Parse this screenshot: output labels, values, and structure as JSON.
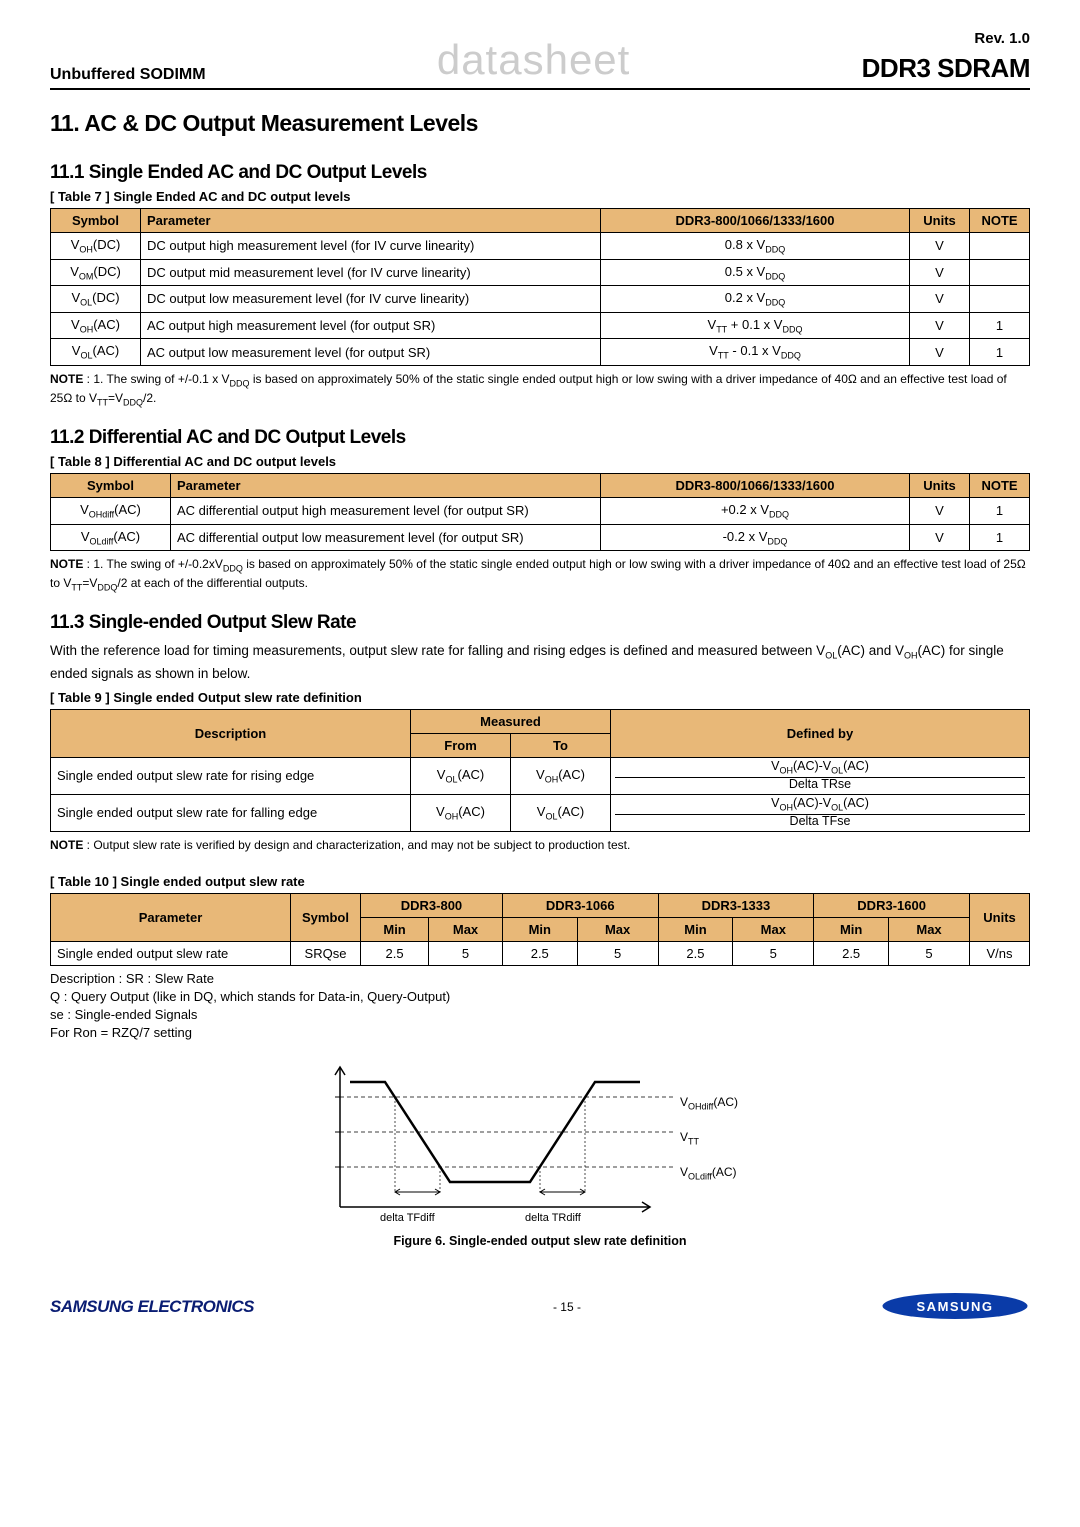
{
  "header": {
    "left": "Unbuffered SODIMM",
    "center": "datasheet",
    "rev": "Rev. 1.0",
    "title": "DDR3 SDRAM"
  },
  "h1": "11. AC & DC Output Measurement Levels",
  "sec1": {
    "heading": "11.1 Single Ended AC and DC Output Levels",
    "caption": "[ Table 7 ] Single Ended AC and DC output levels",
    "th_symbol": "Symbol",
    "th_parameter": "Parameter",
    "th_speed": "DDR3-800/1066/1333/1600",
    "th_units": "Units",
    "th_note": "NOTE",
    "rows": [
      {
        "sym": "V",
        "sub": "OH",
        "suf": "(DC)",
        "param": "DC output high measurement level (for IV curve linearity)",
        "val": "0.8 x V",
        "vsub": "DDQ",
        "units": "V",
        "note": ""
      },
      {
        "sym": "V",
        "sub": "OM",
        "suf": "(DC)",
        "param": "DC output mid measurement level (for IV curve linearity)",
        "val": "0.5 x V",
        "vsub": "DDQ",
        "units": "V",
        "note": ""
      },
      {
        "sym": "V",
        "sub": "OL",
        "suf": "(DC)",
        "param": "DC output low measurement level (for IV curve linearity)",
        "val": "0.2 x V",
        "vsub": "DDQ",
        "units": "V",
        "note": ""
      },
      {
        "sym": "V",
        "sub": "OH",
        "suf": "(AC)",
        "param": "AC output high measurement level (for output SR)",
        "val_pre": "V",
        "val_pre_sub": "TT",
        "val_mid": " + 0.1 x V",
        "vsub": "DDQ",
        "units": "V",
        "note": "1"
      },
      {
        "sym": "V",
        "sub": "OL",
        "suf": "(AC)",
        "param": "AC output low measurement level (for output SR)",
        "val_pre": "V",
        "val_pre_sub": "TT",
        "val_mid": " - 0.1 x V",
        "vsub": "DDQ",
        "units": "V",
        "note": "1"
      }
    ],
    "note_label": "NOTE",
    "note_text_1": " : 1. The swing of +/-0.1 x V",
    "note_text_2": " is based on approximately 50% of the static single ended output high or low swing with a driver impedance of 40Ω and an effective test load of 25Ω to V",
    "note_text_3": "=V",
    "note_text_4": "/2."
  },
  "sec2": {
    "heading": "11.2 Differential AC and DC Output Levels",
    "caption": "[ Table 8 ] Differential AC and DC output levels",
    "th_symbol": "Symbol",
    "th_parameter": "Parameter",
    "th_speed": "DDR3-800/1066/1333/1600",
    "th_units": "Units",
    "th_note": "NOTE",
    "rows": [
      {
        "sym": "V",
        "sub": "OHdiff",
        "suf": "(AC)",
        "param": "AC differential output high measurement level (for output SR)",
        "val": "+0.2 x V",
        "vsub": "DDQ",
        "units": "V",
        "note": "1"
      },
      {
        "sym": "V",
        "sub": "OLdiff",
        "suf": "(AC)",
        "param": "AC differential output low measurement level (for output SR)",
        "val": "-0.2 x V",
        "vsub": "DDQ",
        "units": "V",
        "note": "1"
      }
    ],
    "note_label": "NOTE",
    "note_text_1": " : 1. The swing of +/-0.2xV",
    "note_text_2": " is based on approximately 50% of the static single ended output high or low swing with a driver impedance of 40Ω and an effective test load of 25Ω to V",
    "note_text_3": "=V",
    "note_text_4": "/2 at each of the differential outputs."
  },
  "sec3": {
    "heading": "11.3 Single-ended Output Slew Rate",
    "intro_1": "With the reference load for timing measurements, output slew rate for falling and rising edges is defined and measured between V",
    "intro_2": "(AC) and V",
    "intro_3": "(AC) for single ended signals as shown in below.",
    "caption9": "[ Table 9 ] Single ended Output slew rate definition",
    "th_desc": "Description",
    "th_measured": "Measured",
    "th_from": "From",
    "th_to": "To",
    "th_definedby": "Defined by",
    "r1_desc": "Single ended output slew rate for rising edge",
    "r1_from": "V",
    "r1_from_sub": "OL",
    "r1_from_suf": "(AC)",
    "r1_to": "V",
    "r1_to_sub": "OH",
    "r1_to_suf": "(AC)",
    "r1_num": "V",
    "r1_num_sub1": "OH",
    "r1_num_mid": "(AC)-V",
    "r1_num_sub2": "OL",
    "r1_num_suf": "(AC)",
    "r1_den": "Delta TRse",
    "r2_desc": "Single ended output slew rate for falling edge",
    "r2_from": "V",
    "r2_from_sub": "OH",
    "r2_from_suf": "(AC)",
    "r2_to": "V",
    "r2_to_sub": "OL",
    "r2_to_suf": "(AC)",
    "r2_num": "V",
    "r2_num_sub1": "OH",
    "r2_num_mid": "(AC)-V",
    "r2_num_sub2": "OL",
    "r2_num_suf": "(AC)",
    "r2_den": "Delta TFse",
    "note9_label": "NOTE",
    "note9": " : Output slew rate is verified by design and characterization, and may not be subject to production test.",
    "caption10": "[ Table 10 ] Single ended output slew rate",
    "th_param": "Parameter",
    "th_sym": "Symbol",
    "th_d800": "DDR3-800",
    "th_d1066": "DDR3-1066",
    "th_d1333": "DDR3-1333",
    "th_d1600": "DDR3-1600",
    "th_units2": "Units",
    "th_min": "Min",
    "th_max": "Max",
    "r10": {
      "param": "Single ended output slew rate",
      "sym": "SRQse",
      "d800min": "2.5",
      "d800max": "5",
      "d1066min": "2.5",
      "d1066max": "5",
      "d1333min": "2.5",
      "d1333max": "5",
      "d1600min": "2.5",
      "d1600max": "5",
      "units": "V/ns"
    },
    "desc_lines": "Description : SR : Slew Rate\nQ : Query Output (like in DQ, which stands for Data-in, Query-Output)\nse : Single-ended Signals\nFor Ron = RZQ/7 setting",
    "diag": {
      "voh": "V",
      "voh_sub": "OHdiff",
      "voh_suf": "(AC)",
      "vtt": "V",
      "vtt_sub": "TT",
      "vol": "V",
      "vol_sub": "OLdiff",
      "vol_suf": "(AC)",
      "tfdiff": "delta TFdiff",
      "trdiff": "delta TRdiff"
    },
    "fig_caption": "Figure 6. Single-ended output slew rate definition"
  },
  "footer": {
    "left": "SAMSUNG ELECTRONICS",
    "mid": "- 15 -",
    "brand": "SAMSUNG"
  }
}
